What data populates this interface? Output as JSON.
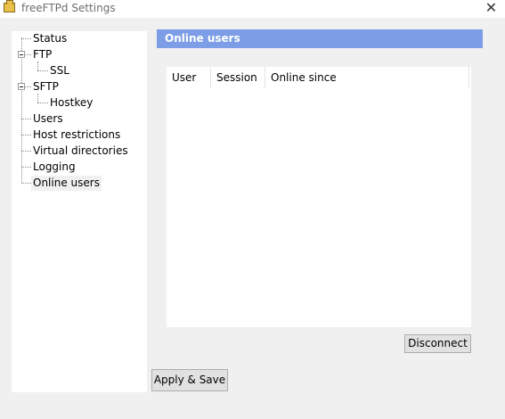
{
  "window": {
    "title": "freeFTPd Settings",
    "close_glyph": "✕"
  },
  "tree": {
    "items": [
      {
        "label": "Status"
      },
      {
        "label": "FTP"
      },
      {
        "label": "SSL"
      },
      {
        "label": "SFTP"
      },
      {
        "label": "Hostkey"
      },
      {
        "label": "Users"
      },
      {
        "label": "Host restrictions"
      },
      {
        "label": "Virtual directories"
      },
      {
        "label": "Logging"
      },
      {
        "label": "Online users",
        "selected": true
      }
    ]
  },
  "panel": {
    "title": "Online users",
    "columns": [
      "User",
      "Session",
      "Online since"
    ],
    "rows": []
  },
  "buttons": {
    "disconnect": "Disconnect",
    "apply": "Apply & Save"
  },
  "colors": {
    "header_bg": "#7d9ee6",
    "window_bg": "#f0f0f0"
  }
}
